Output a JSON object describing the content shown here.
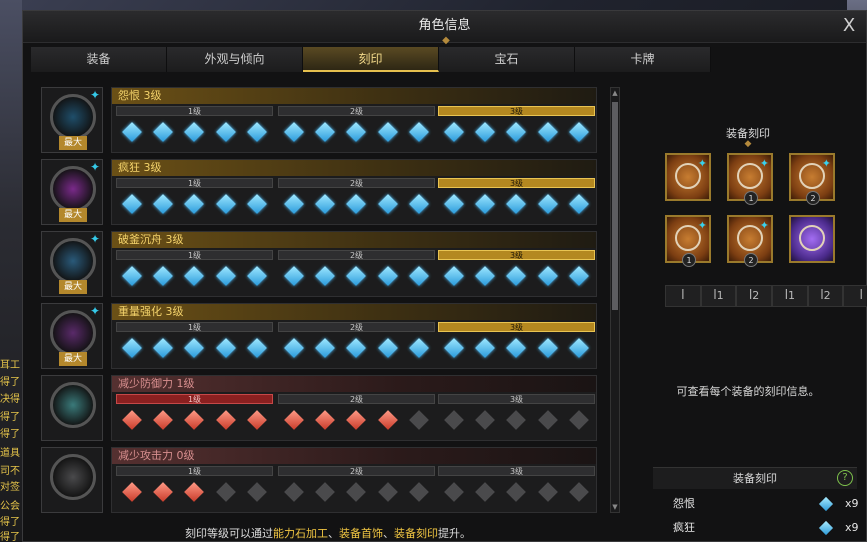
{
  "window": {
    "title": "角色信息",
    "close": "X"
  },
  "tabs": [
    {
      "label": "装备"
    },
    {
      "label": "外观与倾向"
    },
    {
      "label": "刻印",
      "active": true
    },
    {
      "label": "宝石"
    },
    {
      "label": "卡牌"
    }
  ],
  "chat_lines": [
    "耳工",
    "得了",
    "决得",
    "得了",
    "得了",
    "道具",
    "司不",
    "对签",
    "公会",
    "得了",
    "得了"
  ],
  "engravings": [
    {
      "name": "怨恨 3级",
      "badge": "最大",
      "type": "gold",
      "level_labels": [
        "1级",
        "2级",
        "3级"
      ],
      "active_level": 3,
      "gems": [
        [
          "blue",
          "blue",
          "blue",
          "blue",
          "blue"
        ],
        [
          "blue",
          "blue",
          "blue",
          "blue",
          "blue"
        ],
        [
          "blue",
          "blue",
          "blue",
          "blue",
          "blue"
        ]
      ],
      "icon_color": "#1f4e6a"
    },
    {
      "name": "疯狂 3级",
      "badge": "最大",
      "type": "gold",
      "level_labels": [
        "1级",
        "2级",
        "3级"
      ],
      "active_level": 3,
      "gems": [
        [
          "blue",
          "blue",
          "blue",
          "blue",
          "blue"
        ],
        [
          "blue",
          "blue",
          "blue",
          "blue",
          "blue"
        ],
        [
          "blue",
          "blue",
          "blue",
          "blue",
          "blue"
        ]
      ],
      "icon_color": "#7a2a8a"
    },
    {
      "name": "破釜沉舟 3级",
      "badge": "最大",
      "type": "gold",
      "level_labels": [
        "1级",
        "2级",
        "3级"
      ],
      "active_level": 3,
      "gems": [
        [
          "blue",
          "blue",
          "blue",
          "blue",
          "blue"
        ],
        [
          "blue",
          "blue",
          "blue",
          "blue",
          "blue"
        ],
        [
          "blue",
          "blue",
          "blue",
          "blue",
          "blue"
        ]
      ],
      "icon_color": "#2a5a7a"
    },
    {
      "name": "重量强化 3级",
      "badge": "最大",
      "type": "gold",
      "level_labels": [
        "1级",
        "2级",
        "3级"
      ],
      "active_level": 3,
      "gems": [
        [
          "blue",
          "blue",
          "blue",
          "blue",
          "blue"
        ],
        [
          "blue",
          "blue",
          "blue",
          "blue",
          "blue"
        ],
        [
          "blue",
          "blue",
          "blue",
          "blue",
          "blue"
        ]
      ],
      "icon_color": "#5a2a6a"
    },
    {
      "name": "减少防御力 1级",
      "badge": "",
      "type": "red",
      "level_labels": [
        "1级",
        "2级",
        "3级"
      ],
      "active_level": 1,
      "gems": [
        [
          "red",
          "red",
          "red",
          "red",
          "red"
        ],
        [
          "red",
          "red",
          "red",
          "red",
          "gray"
        ],
        [
          "gray",
          "gray",
          "gray",
          "gray",
          "gray"
        ]
      ],
      "icon_color": "#3a7a7a"
    },
    {
      "name": "减少攻击力 0级",
      "badge": "",
      "type": "red",
      "level_labels": [
        "1级",
        "2级",
        "3级"
      ],
      "active_level": 0,
      "gems": [
        [
          "red",
          "red",
          "red",
          "gray",
          "gray"
        ],
        [
          "gray",
          "gray",
          "gray",
          "gray",
          "gray"
        ],
        [
          "gray",
          "gray",
          "gray",
          "gray",
          "gray"
        ]
      ],
      "icon_color": "#4a4a4c"
    }
  ],
  "footer": {
    "prefix": "刻印等级可以通过",
    "hl1": "能力石加工",
    "sep1": "、",
    "hl2": "装备首饰",
    "sep2": "、",
    "hl3": "装备刻印",
    "suffix": "提升。"
  },
  "right_panel": {
    "title": "装备刻印",
    "equipment": [
      {
        "name": "necklace",
        "num": ""
      },
      {
        "name": "earring-1",
        "num": "1"
      },
      {
        "name": "earring-2",
        "num": "2"
      },
      {
        "name": "ring-1",
        "num": "1"
      },
      {
        "name": "ring-2",
        "num": "2"
      },
      {
        "name": "ability-stone",
        "num": ""
      }
    ],
    "slot_labels": [
      "ꟾ",
      "ꟾ1",
      "ꟾ2",
      "ꟾ1",
      "ꟾ2",
      "ꟾ"
    ],
    "info": "可查看每个装备的刻印信息。",
    "equip_bar_title": "装备刻印",
    "help": "?",
    "engravings": [
      {
        "name": "怨恨",
        "value": "x9"
      },
      {
        "name": "疯狂",
        "value": "x9"
      }
    ]
  }
}
